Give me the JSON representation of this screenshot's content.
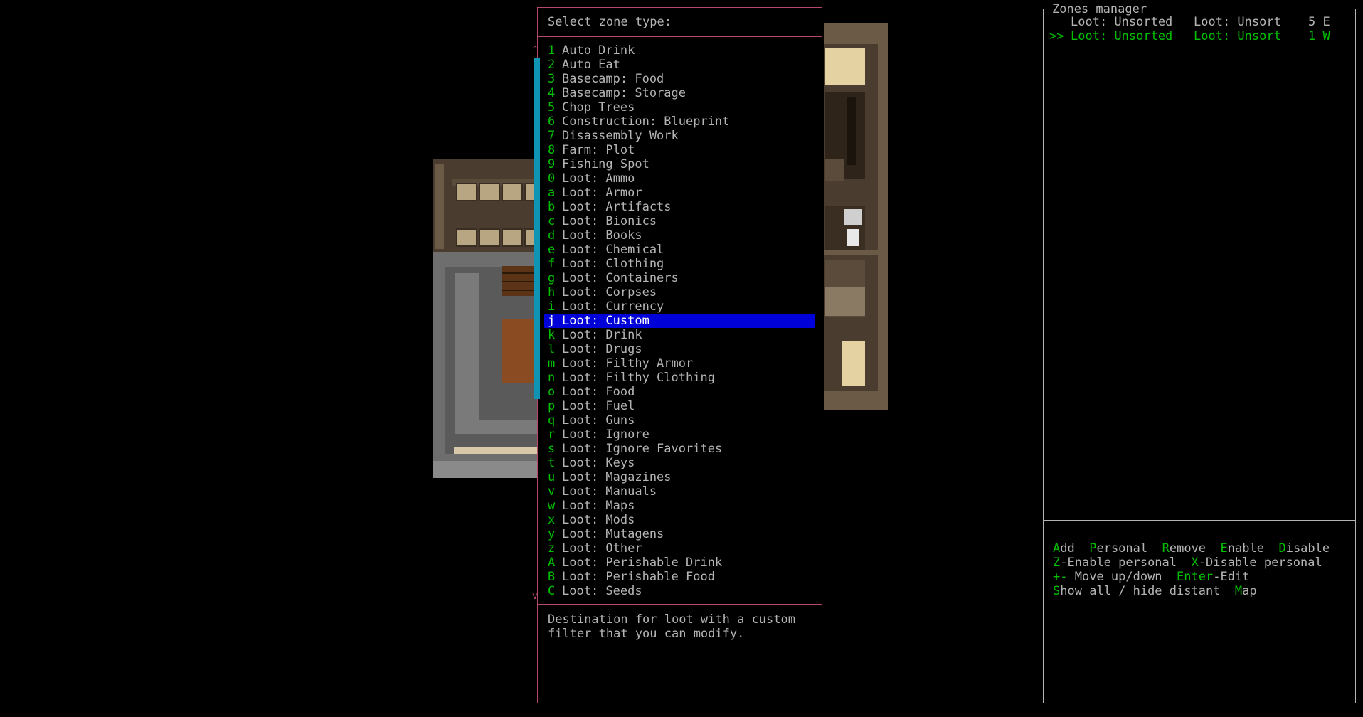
{
  "zone_menu": {
    "title": "Select zone type:",
    "options": [
      {
        "key": "1",
        "label": "Auto Drink"
      },
      {
        "key": "2",
        "label": "Auto Eat"
      },
      {
        "key": "3",
        "label": "Basecamp: Food"
      },
      {
        "key": "4",
        "label": "Basecamp: Storage"
      },
      {
        "key": "5",
        "label": "Chop Trees"
      },
      {
        "key": "6",
        "label": "Construction: Blueprint"
      },
      {
        "key": "7",
        "label": "Disassembly Work"
      },
      {
        "key": "8",
        "label": "Farm: Plot"
      },
      {
        "key": "9",
        "label": "Fishing Spot"
      },
      {
        "key": "0",
        "label": "Loot: Ammo"
      },
      {
        "key": "a",
        "label": "Loot: Armor"
      },
      {
        "key": "b",
        "label": "Loot: Artifacts"
      },
      {
        "key": "c",
        "label": "Loot: Bionics"
      },
      {
        "key": "d",
        "label": "Loot: Books"
      },
      {
        "key": "e",
        "label": "Loot: Chemical"
      },
      {
        "key": "f",
        "label": "Loot: Clothing"
      },
      {
        "key": "g",
        "label": "Loot: Containers"
      },
      {
        "key": "h",
        "label": "Loot: Corpses"
      },
      {
        "key": "i",
        "label": "Loot: Currency"
      },
      {
        "key": "j",
        "label": "Loot: Custom"
      },
      {
        "key": "k",
        "label": "Loot: Drink"
      },
      {
        "key": "l",
        "label": "Loot: Drugs"
      },
      {
        "key": "m",
        "label": "Loot: Filthy Armor"
      },
      {
        "key": "n",
        "label": "Loot: Filthy Clothing"
      },
      {
        "key": "o",
        "label": "Loot: Food"
      },
      {
        "key": "p",
        "label": "Loot: Fuel"
      },
      {
        "key": "q",
        "label": "Loot: Guns"
      },
      {
        "key": "r",
        "label": "Loot: Ignore"
      },
      {
        "key": "s",
        "label": "Loot: Ignore Favorites"
      },
      {
        "key": "t",
        "label": "Loot: Keys"
      },
      {
        "key": "u",
        "label": "Loot: Magazines"
      },
      {
        "key": "v",
        "label": "Loot: Manuals"
      },
      {
        "key": "w",
        "label": "Loot: Maps"
      },
      {
        "key": "x",
        "label": "Loot: Mods"
      },
      {
        "key": "y",
        "label": "Loot: Mutagens"
      },
      {
        "key": "z",
        "label": "Loot: Other"
      },
      {
        "key": "A",
        "label": "Loot: Perishable Drink"
      },
      {
        "key": "B",
        "label": "Loot: Perishable Food"
      },
      {
        "key": "C",
        "label": "Loot: Seeds"
      }
    ],
    "selected_label": "Loot: Custom",
    "scroll_up": "^",
    "scroll_down": "v",
    "description_line1": "Destination for loot with a custom",
    "description_line2": "filter that you can modify."
  },
  "zones_manager": {
    "title": "Zones manager",
    "zones": [
      {
        "prefix": "",
        "name": "Loot: Unsorted",
        "type": "Loot: Unsort",
        "dist": "5 E",
        "selected": false
      },
      {
        "prefix": ">>",
        "name": "Loot: Unsorted",
        "type": "Loot: Unsort",
        "dist": "1 W",
        "selected": true
      }
    ],
    "help": {
      "add_key": "A",
      "add_rest": "dd",
      "personal_key": "P",
      "personal_rest": "ersonal",
      "remove_key": "R",
      "remove_rest": "emove",
      "enable_key": "E",
      "enable_rest": "nable",
      "disable_key": "D",
      "disable_rest": "isable",
      "z_key": "Z",
      "z_rest": "-Enable personal",
      "x_key": "X",
      "x_rest": "-Disable personal",
      "move_key": "+-",
      "move_rest": " Move up/down",
      "enter_key": "Enter",
      "enter_rest": "-Edit",
      "show_key": "S",
      "show_rest": "how all / hide distant",
      "map_key": "M",
      "map_rest": "ap"
    }
  },
  "colors": {
    "accent_green": "#00c000",
    "border_pink": "#b4476a",
    "highlight_blue": "#0000d8",
    "scrollbar": "#1094b4"
  }
}
